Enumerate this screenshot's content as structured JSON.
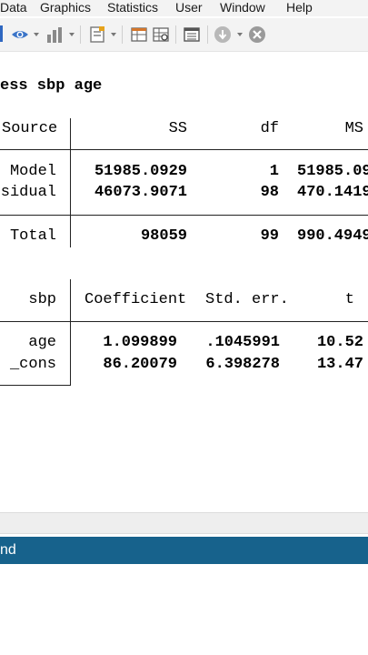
{
  "menu": [
    "Data",
    "Graphics",
    "Statistics",
    "User",
    "Window",
    "Help"
  ],
  "command_echo": "ess sbp age",
  "anova": {
    "headers": {
      "source": "Source",
      "ss": "SS",
      "df": "df",
      "ms": "MS"
    },
    "rows": [
      {
        "source": "Model",
        "ss": "51985.0929",
        "df": "1",
        "ms": "51985.09"
      },
      {
        "source": "sidual",
        "ss": "46073.9071",
        "df": "98",
        "ms": "470.1419"
      },
      {
        "source": "Total",
        "ss": "98059",
        "df": "99",
        "ms": "990.4949"
      }
    ]
  },
  "coef": {
    "headers": {
      "var": "sbp",
      "coef": "Coefficient",
      "se": "Std. err.",
      "t": "t"
    },
    "rows": [
      {
        "var": "age",
        "coef": "1.099899",
        "se": ".1045991",
        "t": "10.52"
      },
      {
        "var": "_cons",
        "coef": "86.20079",
        "se": "6.398278",
        "t": "13.47"
      }
    ]
  },
  "command_bar_label": "nd",
  "colors": {
    "command_bar": "#17628c",
    "toolbar_accent": "#2f67c1"
  },
  "icons": [
    "eye-icon",
    "bar-chart-icon",
    "do-file-editor-icon",
    "data-editor-icon",
    "data-browser-icon",
    "variables-manager-icon",
    "more-icon",
    "break-icon"
  ]
}
